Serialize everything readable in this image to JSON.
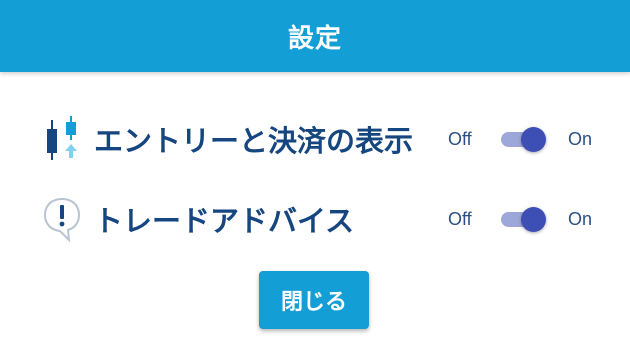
{
  "header": {
    "title": "設定"
  },
  "settings": [
    {
      "label": "エントリーと決済の表示",
      "icon": "candlestick-chart-icon",
      "off_label": "Off",
      "on_label": "On",
      "enabled": true
    },
    {
      "label": "トレードアドバイス",
      "icon": "exclamation-speech-bubble-icon",
      "off_label": "Off",
      "on_label": "On",
      "enabled": true
    }
  ],
  "footer": {
    "close_label": "閉じる"
  },
  "colors": {
    "header_bg": "#139fd5",
    "label_text": "#16467f",
    "toggle_track": "#9ea7d9",
    "toggle_knob": "#3d4fb5",
    "button_bg": "#139fd5"
  }
}
